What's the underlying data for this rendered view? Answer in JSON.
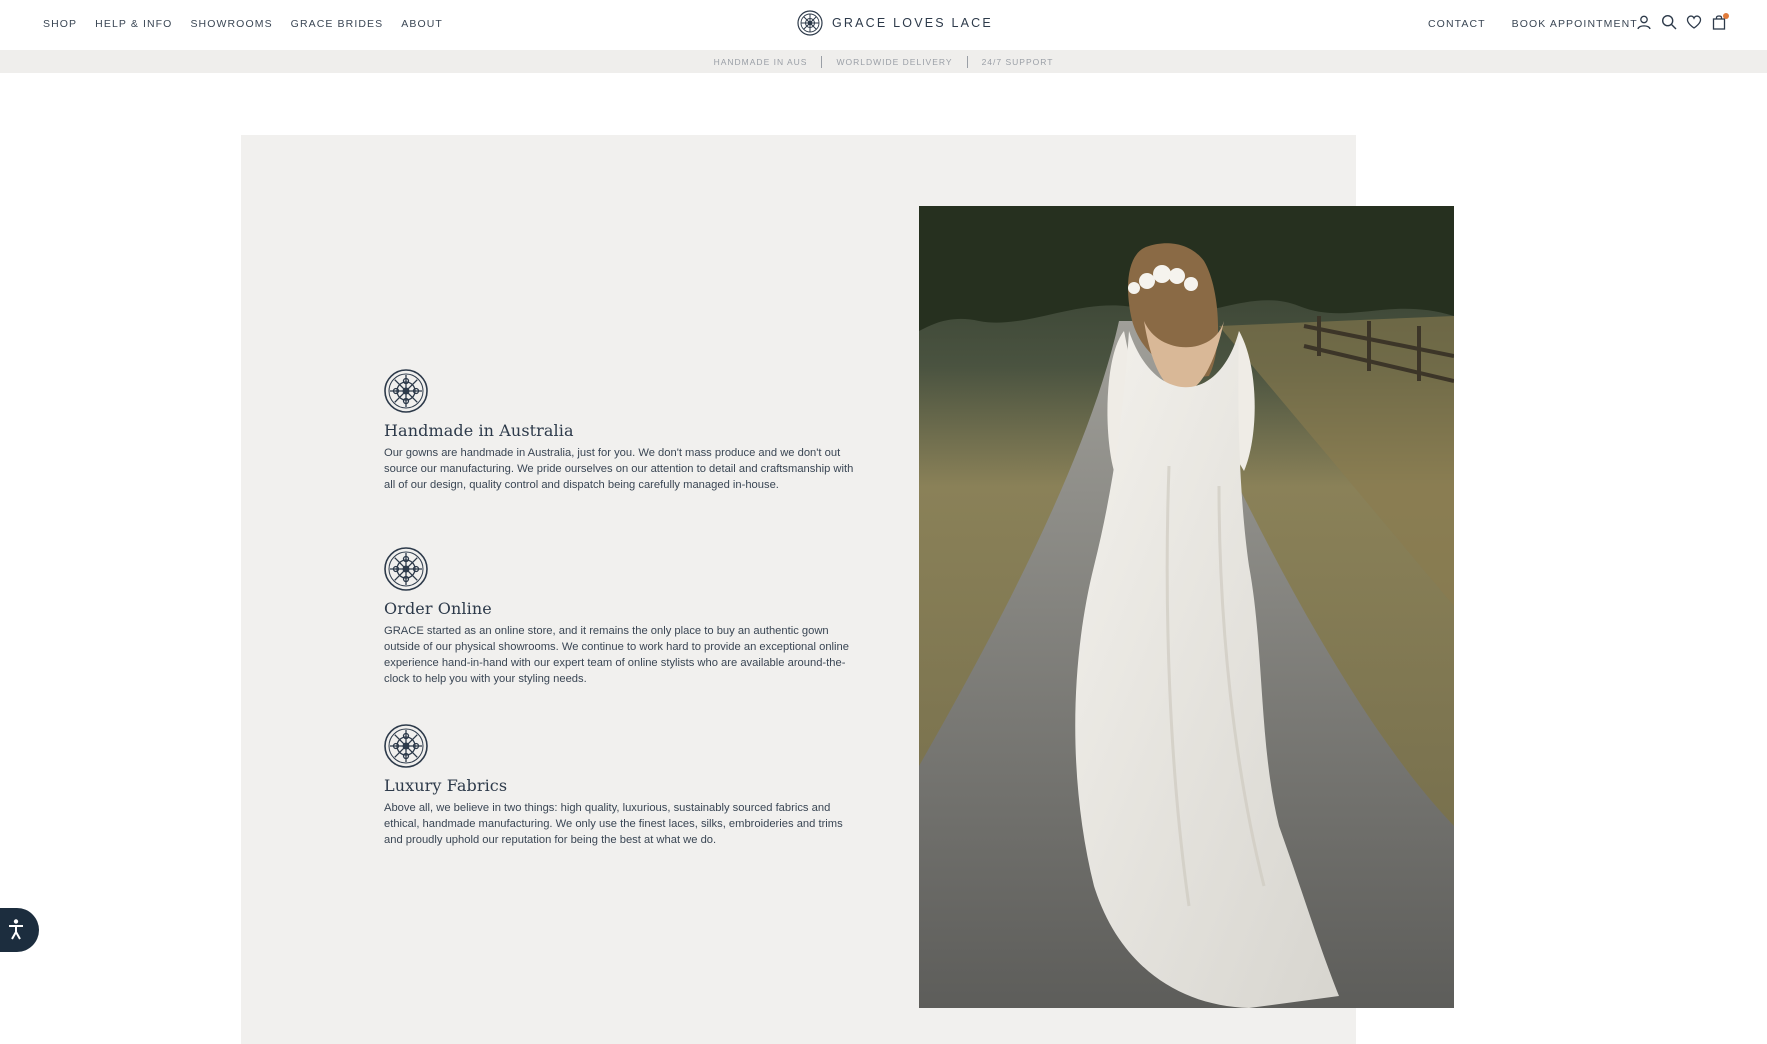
{
  "header": {
    "nav_left": [
      "SHOP",
      "HELP & INFO",
      "SHOWROOMS",
      "GRACE BRIDES",
      "ABOUT"
    ],
    "brand": "GRACE LOVES LACE",
    "nav_right": [
      "CONTACT",
      "BOOK APPOINTMENT"
    ],
    "icons": [
      "account-icon",
      "search-icon",
      "heart-icon",
      "bag-icon"
    ]
  },
  "announcement": [
    "HANDMADE IN AUS",
    "WORLDWIDE DELIVERY",
    "24/7 SUPPORT"
  ],
  "features": [
    {
      "title": "Handmade in Australia",
      "text": "Our gowns are handmade in Australia, just for you. We don't mass produce and we don't out source our manufacturing. We pride ourselves on our attention to detail and craftsmanship with all of our design, quality control and dispatch being carefully managed in-house."
    },
    {
      "title": "Order Online",
      "text": "GRACE started as an online store, and it remains the only place to buy an authentic gown outside of our physical showrooms. We continue to work hard to provide an exceptional online experience hand-in-hand with our expert team of online stylists who are available around-the-clock to help you with your styling needs."
    },
    {
      "title": "Luxury Fabrics",
      "text": "Above all, we believe in two things: high quality, luxurious, sustainably sourced fabrics and ethical, handmade manufacturing. We only use the finest laces, silks, embroideries and trims and proudly uphold our reputation for being the best at what we do."
    }
  ],
  "colors": {
    "navy": "#1c2d3e",
    "text": "#3a4654",
    "panel_bg": "#f1f0ee",
    "announce_bg": "#efeeec",
    "cart_dot": "#e07a3a"
  }
}
